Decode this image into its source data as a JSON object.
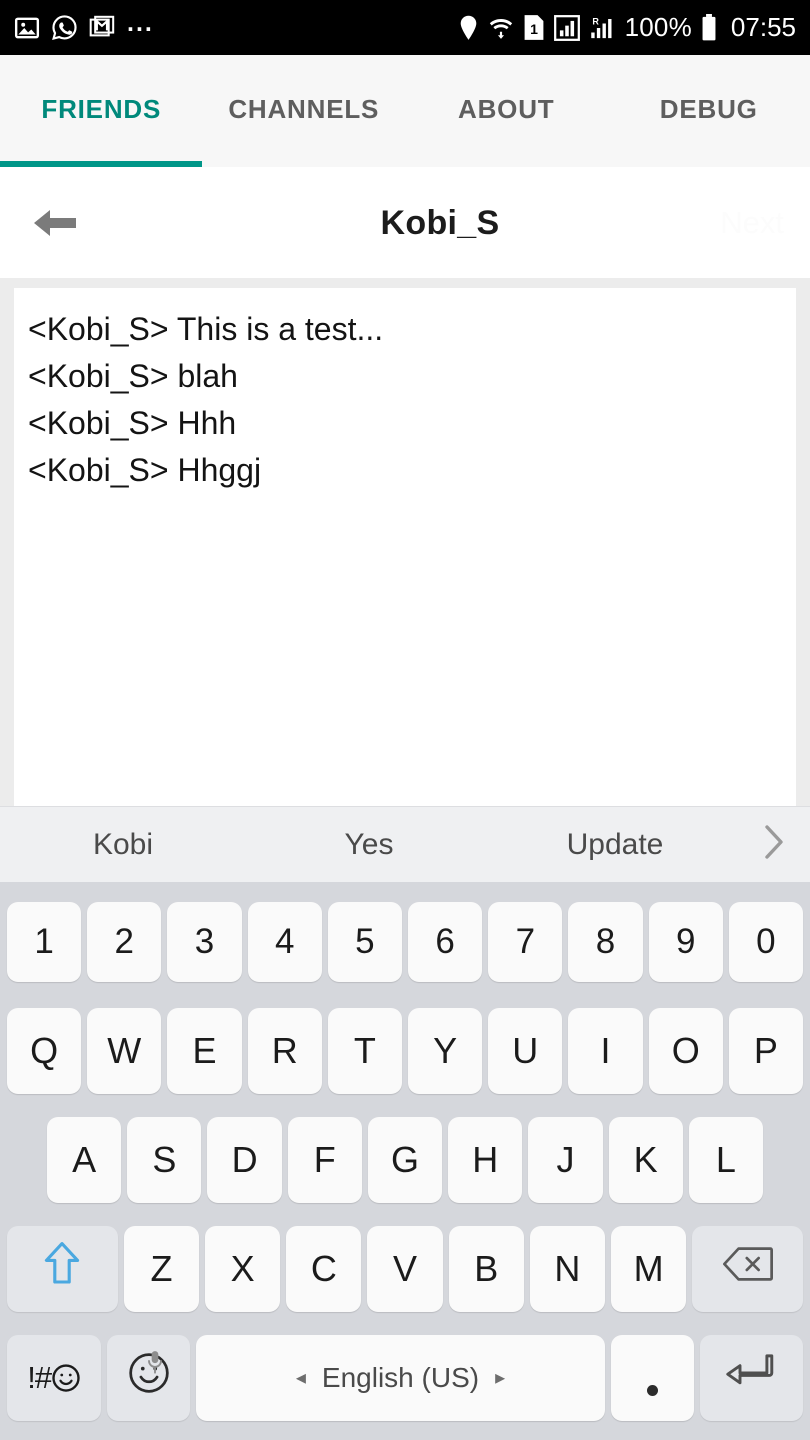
{
  "statusbar": {
    "left_icons": [
      "photos-icon",
      "whatsapp-icon",
      "gmail-icon"
    ],
    "overflow": "...",
    "right_icons": [
      "location-pin-icon",
      "wifi-icon",
      "sim1-icon",
      "signal-boxed-icon",
      "roaming-signal-icon"
    ],
    "battery_percent": "100%",
    "battery_icon": "battery-full-icon",
    "time": "07:55"
  },
  "tabs": {
    "items": [
      {
        "label": "FRIENDS",
        "active": true
      },
      {
        "label": "CHANNELS",
        "active": false
      },
      {
        "label": "ABOUT",
        "active": false
      },
      {
        "label": "DEBUG",
        "active": false
      }
    ],
    "active_color": "#009688",
    "inactive_color": "#5e5e5e"
  },
  "titlebar": {
    "back_icon": "back-arrow-icon",
    "title": "Kobi_S",
    "next_label": "Next"
  },
  "messages": {
    "lines": [
      "<Kobi_S> This is a test...",
      "<Kobi_S> blah",
      "<Kobi_S> Hhh",
      "<Kobi_S> Hhggj"
    ]
  },
  "suggestions": {
    "items": [
      "Kobi",
      "Yes",
      "Update"
    ],
    "expand_icon": "chevron-right-icon"
  },
  "keyboard": {
    "row_numbers": [
      "1",
      "2",
      "3",
      "4",
      "5",
      "6",
      "7",
      "8",
      "9",
      "0"
    ],
    "row_q": [
      "Q",
      "W",
      "E",
      "R",
      "T",
      "Y",
      "U",
      "I",
      "O",
      "P"
    ],
    "row_a": [
      "A",
      "S",
      "D",
      "F",
      "G",
      "H",
      "J",
      "K",
      "L"
    ],
    "row_z": [
      "Z",
      "X",
      "C",
      "V",
      "B",
      "N",
      "M"
    ],
    "shift_icon": "shift-arrow-icon",
    "backspace_icon": "backspace-icon",
    "symbols_label": "!#",
    "symbols_icon": "smiley-icon",
    "emoji_icon": "smiley-icon",
    "mic_icon": "microphone-icon",
    "space_label": "English (US)",
    "space_prev_icon": "triangle-left-icon",
    "space_next_icon": "triangle-right-icon",
    "period_label": ".",
    "enter_icon": "enter-return-icon",
    "bg_color": "#d5d7dc",
    "key_color": "#fafafa",
    "func_key_color": "#e4e6ea",
    "shift_accent": "#4aa8e0"
  }
}
